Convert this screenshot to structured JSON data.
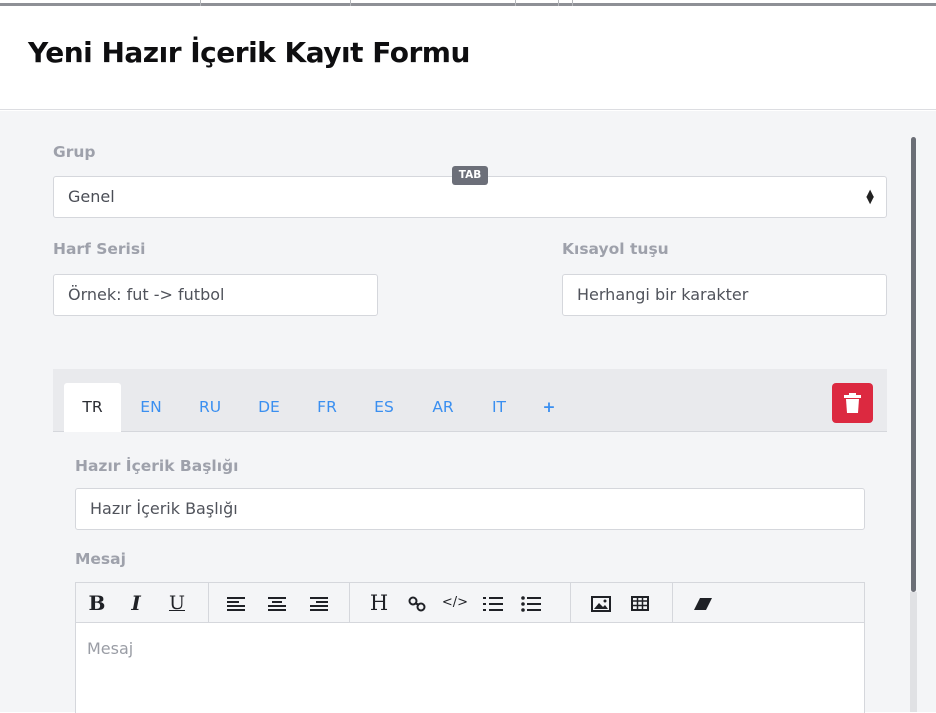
{
  "page": {
    "title": "Yeni Hazır İçerik Kayıt Formu"
  },
  "form": {
    "group": {
      "label": "Grup",
      "value": "Genel"
    },
    "letter_series": {
      "label": "Harf Serisi",
      "placeholder": "Örnek: fut -> futbol"
    },
    "tab_badge": "TAB",
    "shortcut": {
      "label": "Kısayol tuşu",
      "placeholder": "Herhangi bir karakter"
    }
  },
  "language_tabs": [
    "TR",
    "EN",
    "RU",
    "DE",
    "FR",
    "ES",
    "AR",
    "IT",
    "+"
  ],
  "active_tab": "TR",
  "content": {
    "title_label": "Hazır İçerik Başlığı",
    "title_placeholder": "Hazır İçerik Başlığı",
    "message_label": "Mesaj",
    "message_placeholder": "Mesaj"
  },
  "toolbar": {
    "bold": "B",
    "italic": "I",
    "underline": "U",
    "heading": "H",
    "code": "</>"
  },
  "colors": {
    "accent": "#3a8ff0",
    "danger": "#dc2940",
    "label": "#9ea1ab"
  }
}
